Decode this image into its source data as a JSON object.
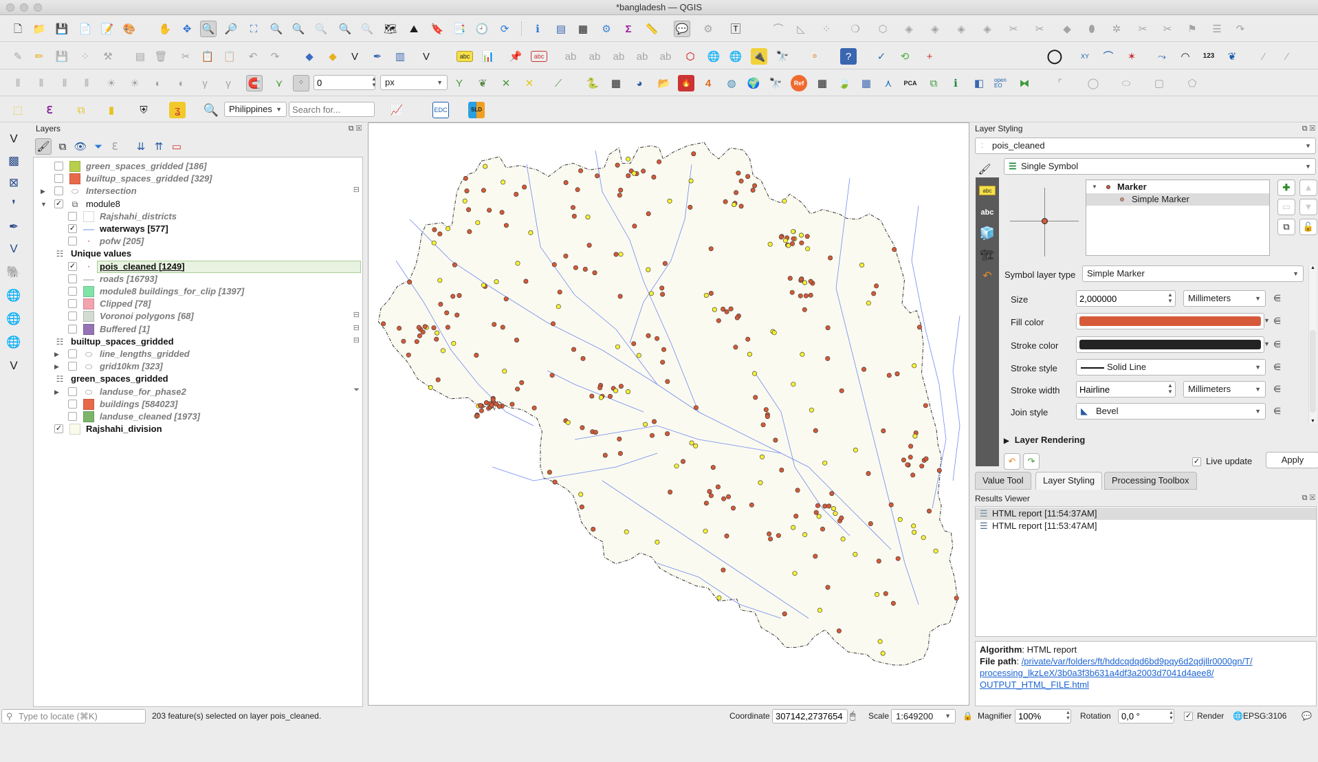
{
  "window": {
    "title": "*bangladesh — QGIS"
  },
  "toolbar": {
    "snapping_tolerance_value": "0",
    "snapping_units": "px",
    "geocoder_country": "Philippines",
    "search_placeholder": "Search for...",
    "edc_label": "EDC",
    "sld_label": "SLD",
    "num_label": "123",
    "xy_label": "XY",
    "ref_label": "Ref",
    "pca_label": "PCA",
    "openeo_label": "open EO",
    "abc_label": "abc"
  },
  "layers_panel": {
    "title": "Layers",
    "items": [
      {
        "name": "green_spaces_gridded [186]",
        "checked": false,
        "style": "italic",
        "swatch": "#b8cf4e",
        "indent": 1
      },
      {
        "name": "builtup_spaces_gridded [329]",
        "checked": false,
        "style": "italic",
        "swatch": "#e8694a",
        "indent": 1
      },
      {
        "name": "Intersection",
        "checked": false,
        "style": "italic",
        "swatch": "polygon-icon",
        "indent": 1,
        "expander": "collapsed"
      },
      {
        "name": "module8",
        "checked": true,
        "style": "group",
        "swatch": "group-icon",
        "indent": 1,
        "expander": "expanded"
      },
      {
        "name": "Rajshahi_districts",
        "checked": false,
        "style": "italic",
        "swatch": "#ffffff",
        "indent": 2
      },
      {
        "name": "waterways [577]",
        "checked": true,
        "style": "bold",
        "swatch": "line-blue",
        "indent": 2
      },
      {
        "name": "pofw [205]",
        "checked": false,
        "style": "italic",
        "swatch": "point",
        "indent": 2
      },
      {
        "name": "Unique values",
        "checked": null,
        "style": "bold",
        "swatch": "table-icon",
        "indent": 1.5
      },
      {
        "name": "pois_cleaned [1249]",
        "checked": true,
        "style": "selected",
        "swatch": "point",
        "indent": 2
      },
      {
        "name": "roads [16793]",
        "checked": false,
        "style": "italic",
        "swatch": "line-gray",
        "indent": 2
      },
      {
        "name": "module8 buildings_for_clip [1397]",
        "checked": false,
        "style": "italic",
        "swatch": "#7fe3a8",
        "indent": 2
      },
      {
        "name": "Clipped [78]",
        "checked": false,
        "style": "italic",
        "swatch": "#f2a3ae",
        "indent": 2
      },
      {
        "name": "Voronoi polygons [68]",
        "checked": false,
        "style": "italic",
        "swatch": "#d3dcd0",
        "indent": 2
      },
      {
        "name": "Buffered [1]",
        "checked": false,
        "style": "italic",
        "swatch": "#9673b4",
        "indent": 2
      },
      {
        "name": "builtup_spaces_gridded",
        "checked": null,
        "style": "bold",
        "swatch": "table-icon",
        "indent": 1.5
      },
      {
        "name": "line_lengths_gridded",
        "checked": false,
        "style": "italic",
        "swatch": "polygon-icon",
        "indent": 2,
        "expander": "collapsed"
      },
      {
        "name": "grid10km [323]",
        "checked": false,
        "style": "italic",
        "swatch": "polygon-icon",
        "indent": 2,
        "expander": "collapsed"
      },
      {
        "name": "green_spaces_gridded",
        "checked": null,
        "style": "bold",
        "swatch": "table-icon",
        "indent": 1.5
      },
      {
        "name": "landuse_for_phase2",
        "checked": false,
        "style": "italic",
        "swatch": "polygon-icon",
        "indent": 2,
        "expander": "collapsed"
      },
      {
        "name": "buildings [584023]",
        "checked": false,
        "style": "italic",
        "swatch": "#e8694a",
        "indent": 2
      },
      {
        "name": "landuse_cleaned [1973]",
        "checked": false,
        "style": "italic",
        "swatch": "#7cb56a",
        "indent": 2
      },
      {
        "name": "Rajshahi_division",
        "checked": true,
        "style": "bold",
        "swatch": "#fbfbeb",
        "indent": 1
      }
    ]
  },
  "map": {
    "background": "#ffffff",
    "region_fill": "#fafaf0",
    "river_color": "#4f6df0",
    "poi_colors": [
      "#d35a38",
      "#f6f034"
    ],
    "layer_shown": "Rajshahi_division"
  },
  "layer_styling": {
    "title": "Layer Styling",
    "layer": "pois_cleaned",
    "renderer": "Single Symbol",
    "tree": [
      {
        "label": "Marker",
        "level": 0
      },
      {
        "label": "Simple Marker",
        "level": 1
      }
    ],
    "symbol_layer_type_label": "Symbol layer type",
    "symbol_layer_type": "Simple Marker",
    "fields": {
      "size_label": "Size",
      "size_value": "2,000000",
      "size_units": "Millimeters",
      "fill_color_label": "Fill color",
      "fill_color": "#d65a3a",
      "stroke_color_label": "Stroke color",
      "stroke_color": "#232323",
      "stroke_style_label": "Stroke style",
      "stroke_style": "Solid Line",
      "stroke_width_label": "Stroke width",
      "stroke_width": "Hairline",
      "stroke_width_units": "Millimeters",
      "join_style_label": "Join style",
      "join_style": "Bevel"
    },
    "layer_rendering": "Layer Rendering",
    "live_update_label": "Live update",
    "live_update": true,
    "apply_label": "Apply"
  },
  "dock_tabs": [
    {
      "label": "Value Tool",
      "selected": false
    },
    {
      "label": "Layer Styling",
      "selected": true
    },
    {
      "label": "Processing Toolbox",
      "selected": false
    }
  ],
  "results_viewer": {
    "title": "Results Viewer",
    "items": [
      "HTML report [11:54:37AM]",
      "HTML report [11:53:47AM]"
    ],
    "algorithm_label": "Algorithm",
    "algorithm": "HTML report",
    "file_path_label": "File path",
    "file_path_lines": [
      "/private/var/folders/ft/hddcqdqd6bd9pqy6d2qdjllr0000gn/T/",
      "processing_lkzLeX/3b0a3f3b631a4df3a2003d7041d4aee8/",
      "OUTPUT_HTML_FILE.html"
    ]
  },
  "statusbar": {
    "locator_placeholder": "Type to locate (⌘K)",
    "message": "203 feature(s) selected on layer pois_cleaned.",
    "coordinate_label": "Coordinate",
    "coordinate": "307142,2737654",
    "scale_label": "Scale",
    "scale": "1:649200",
    "magnifier_label": "Magnifier",
    "magnifier": "100%",
    "rotation_label": "Rotation",
    "rotation": "0,0 °",
    "render_label": "Render",
    "render": true,
    "crs": "EPSG:3106"
  }
}
